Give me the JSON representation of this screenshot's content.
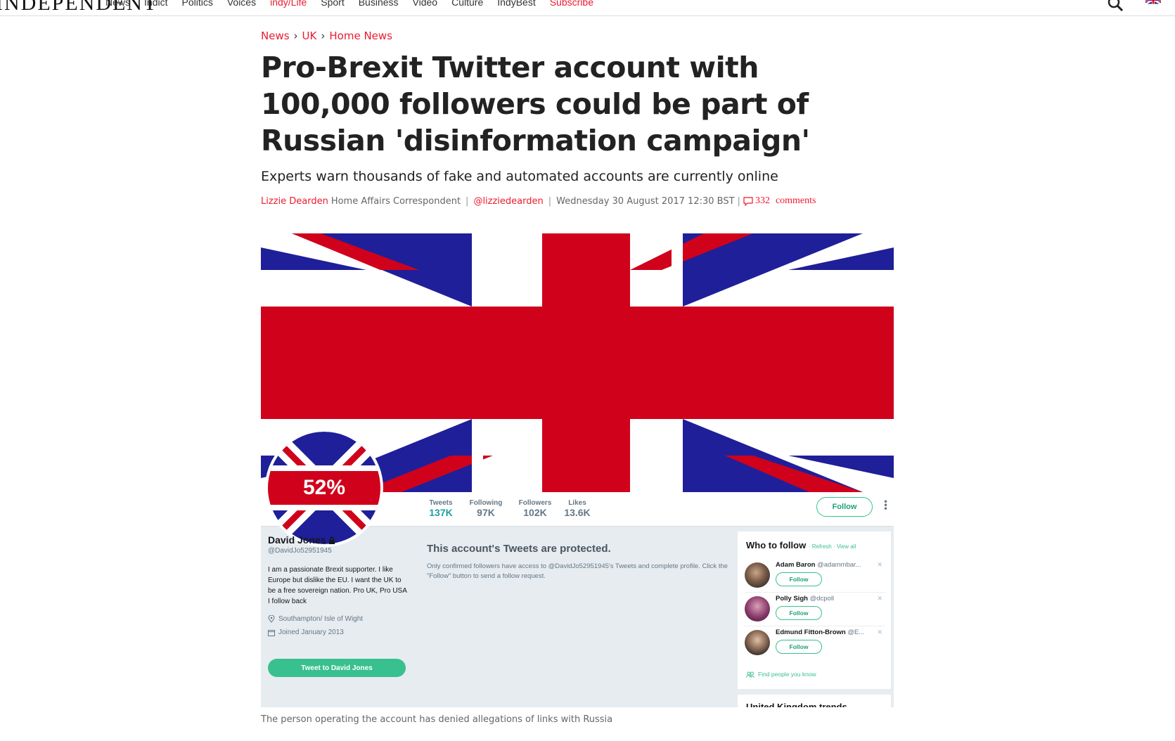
{
  "nav": {
    "logo": "INDEPENDENT",
    "items": [
      "News",
      "Indy/Life",
      "Politics",
      "Voices",
      "indy/Life",
      "Sport",
      "Business",
      "Video",
      "Culture",
      "IndyBest",
      "Subscribe"
    ],
    "display": [
      "News",
      "Indict",
      "Politics",
      "Voices",
      "indy/Life",
      "Sport",
      "Business",
      "Video",
      "Culture",
      "IndyBest",
      "Subscribe"
    ]
  },
  "breadcrumb": {
    "a": "News",
    "b": "UK",
    "c": "Home News",
    "sep": "›"
  },
  "article": {
    "headline": "Pro-Brexit Twitter account with 100,000 followers could be part of Russian 'disinformation campaign'",
    "standfirst": "Experts warn thousands of fake and automated accounts are currently online",
    "author": "Lizzie Dearden",
    "role": "Home Affairs Correspondent",
    "twitter": "@lizziedearden",
    "date": "Wednesday 30 August 2017 12:30 BST",
    "comments_count": "332",
    "comments_label": "comments",
    "caption": "The person operating the account has denied allegations of links with Russia"
  },
  "twitter": {
    "badge": "52%",
    "stats": [
      {
        "label": "Tweets",
        "value": "137K"
      },
      {
        "label": "Following",
        "value": "97K"
      },
      {
        "label": "Followers",
        "value": "102K"
      },
      {
        "label": "Likes",
        "value": "13.6K"
      }
    ],
    "follow": "Follow",
    "name": "David Jones",
    "handle": "@DavidJo52951945",
    "bio": "I am a passionate Brexit supporter. I like Europe but dislike the EU. I want the UK to be a free sovereign nation. Pro UK, Pro USA I follow back",
    "location": "Southampton/ Isle of Wight",
    "joined": "Joined January 2013",
    "tweet_to": "Tweet to David Jones",
    "protected_title": "This account's Tweets are protected.",
    "protected_text": "Only confirmed followers have access to @DavidJo52951945's Tweets and complete profile. Click the \"Follow\" button to send a follow request.",
    "wtf_title": "Who to follow",
    "wtf_links": "· Refresh · View all",
    "wtf": [
      {
        "name": "Adam Baron",
        "handle": "@adammbar..."
      },
      {
        "name": "Polly Sigh",
        "handle": "@dcpoll"
      },
      {
        "name": "Edmund Fitton-Brown",
        "handle": "@E..."
      }
    ],
    "find_people": "Find people you know",
    "trends": "United Kingdom trends"
  },
  "colors": {
    "accent": "#ec1a2e",
    "twitter_green": "#39c08f",
    "flag_red": "#d0021b",
    "flag_blue": "#1f1f9a"
  }
}
